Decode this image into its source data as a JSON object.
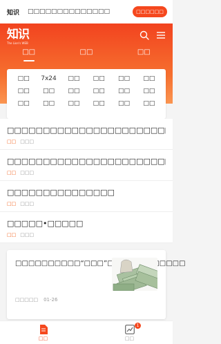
{
  "topbar": {
    "logo_text": "知识",
    "promo_text": "□□□□□□□□□□□□□□",
    "open_label": "□□□□□□"
  },
  "header": {
    "brand_mark": "知识",
    "brand_sub": "The Lion's WEB",
    "tabs": [
      {
        "label": "□□"
      },
      {
        "label": "□□"
      },
      {
        "label": "□□"
      }
    ]
  },
  "categories": [
    "□□",
    "7x24",
    "□□",
    "□□",
    "□□",
    "□□",
    "□□",
    "□□",
    "□□",
    "□□",
    "□□",
    "□□",
    "□□",
    "□□",
    "□□",
    "□□",
    "□□",
    "□□"
  ],
  "news": [
    {
      "title": "□□□□□□□□□□□□□□□□□□□□□□□□□□",
      "tag": "□□",
      "source": "□□□"
    },
    {
      "title": "□□□□□□□□□□□□□□□□□□□□□□□□□□",
      "tag": "□□",
      "source": "□□□"
    },
    {
      "title": "□□□□□□□□□□□□□□□",
      "tag": "□□",
      "source": "□□□"
    },
    {
      "title": "□□□□□•□□□□□",
      "tag": "□□",
      "source": "□□□"
    }
  ],
  "feature": {
    "title": "□□□□□□□□□□“□□□”□□□□□□□□□□□□",
    "source": "□□□□□",
    "date": "01-26"
  },
  "bottom_nav": {
    "items": [
      {
        "label": "□□"
      },
      {
        "label": "□□"
      }
    ],
    "badge": "1"
  },
  "colors": {
    "accent": "#f5481e",
    "header_gradient_top": "#f2431f",
    "header_gradient_bottom": "#fb9551"
  }
}
